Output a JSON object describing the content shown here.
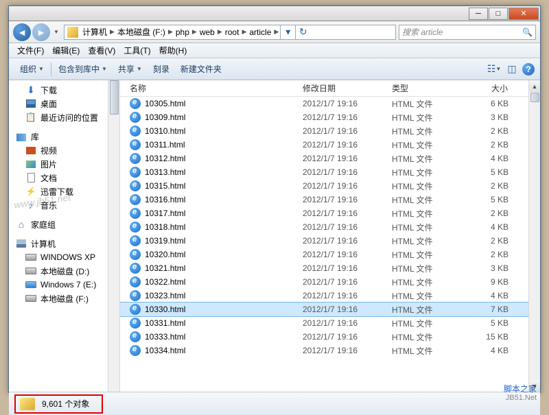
{
  "breadcrumbs": [
    "计算机",
    "本地磁盘 (F:)",
    "php",
    "web",
    "root",
    "article"
  ],
  "search_placeholder": "搜索 article",
  "menus": {
    "file": "文件(F)",
    "edit": "编辑(E)",
    "view": "查看(V)",
    "tools": "工具(T)",
    "help": "帮助(H)"
  },
  "toolbar": {
    "organize": "组织",
    "include": "包含到库中",
    "share": "共享",
    "burn": "刻录",
    "newfolder": "新建文件夹"
  },
  "columns": {
    "name": "名称",
    "date": "修改日期",
    "type": "类型",
    "size": "大小"
  },
  "sidebar": {
    "downloads": "下载",
    "desktop": "桌面",
    "recent": "最近访问的位置",
    "libraries": "库",
    "video": "视频",
    "pictures": "图片",
    "documents": "文档",
    "thunder": "迅雷下载",
    "music": "音乐",
    "homegroup": "家庭组",
    "computer": "计算机",
    "drive_c": "WINDOWS XP",
    "drive_d": "本地磁盘 (D:)",
    "drive_e": "Windows 7 (E:)",
    "drive_f": "本地磁盘 (F:)"
  },
  "file_type": "HTML 文件",
  "file_date": "2012/1/7 19:16",
  "files": [
    {
      "name": "10305.html",
      "size": "6 KB"
    },
    {
      "name": "10309.html",
      "size": "3 KB"
    },
    {
      "name": "10310.html",
      "size": "2 KB"
    },
    {
      "name": "10311.html",
      "size": "2 KB"
    },
    {
      "name": "10312.html",
      "size": "4 KB"
    },
    {
      "name": "10313.html",
      "size": "5 KB"
    },
    {
      "name": "10315.html",
      "size": "2 KB"
    },
    {
      "name": "10316.html",
      "size": "5 KB"
    },
    {
      "name": "10317.html",
      "size": "2 KB"
    },
    {
      "name": "10318.html",
      "size": "4 KB"
    },
    {
      "name": "10319.html",
      "size": "2 KB"
    },
    {
      "name": "10320.html",
      "size": "2 KB"
    },
    {
      "name": "10321.html",
      "size": "3 KB"
    },
    {
      "name": "10322.html",
      "size": "9 KB"
    },
    {
      "name": "10323.html",
      "size": "4 KB"
    },
    {
      "name": "10330.html",
      "size": "7 KB",
      "selected": true
    },
    {
      "name": "10331.html",
      "size": "5 KB"
    },
    {
      "name": "10333.html",
      "size": "15 KB"
    },
    {
      "name": "10334.html",
      "size": "4 KB"
    }
  ],
  "status": "9,601 个对象",
  "watermark": "www.jb51.net",
  "brand": {
    "cn": "脚本之家",
    "en": "JB51.Net"
  }
}
